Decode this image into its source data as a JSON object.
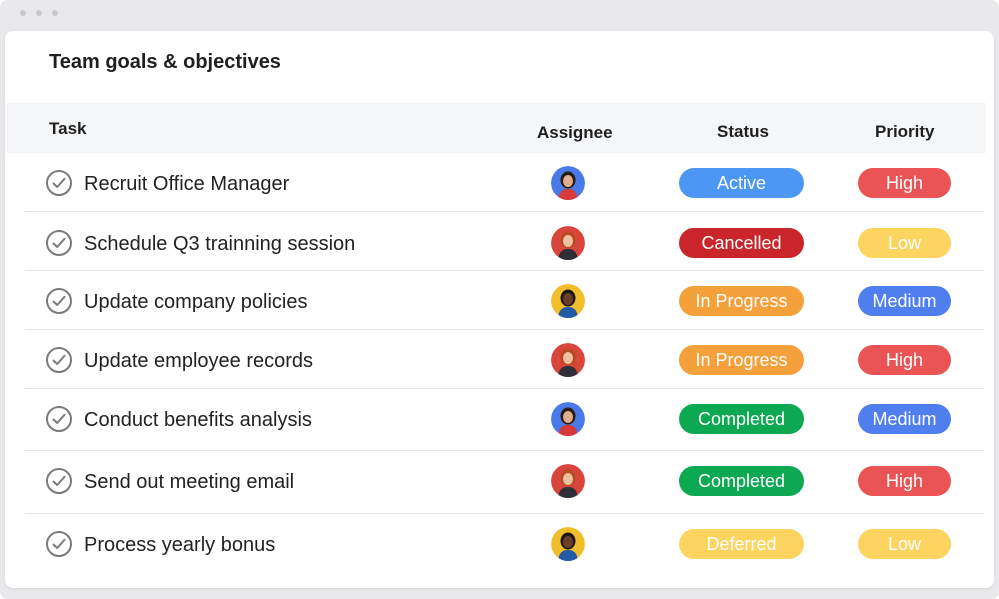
{
  "panel": {
    "title": "Team goals & objectives"
  },
  "columns": {
    "task": "Task",
    "assignee": "Assignee",
    "status": "Status",
    "priority": "Priority"
  },
  "colors": {
    "Active": "#4c97f3",
    "Cancelled": "#c9252b",
    "In Progress": "#f4a03b",
    "Completed": "#0ca952",
    "Deferred": "#fdd460",
    "High": "#ea5455",
    "Low": "#fdd460",
    "Medium": "#4f7fef"
  },
  "avatars": {
    "a": {
      "bg": "#4a7ae8",
      "hair": "#2a1a14",
      "skin": "#e2ae8e",
      "shirt": "#d63a3a"
    },
    "b": {
      "bg": "#d9443c",
      "hair": "#b64b1f",
      "skin": "#efc1a0",
      "shirt": "#2e2e38"
    },
    "c": {
      "bg": "#f2bd2a",
      "hair": "#1a1a1a",
      "skin": "#6a3f28",
      "shirt": "#1f5aa6"
    }
  },
  "rows": [
    {
      "task": "Recruit Office Manager",
      "avatar": "a",
      "avatar_icon": "woman-avatar",
      "status": "Active",
      "priority": "High"
    },
    {
      "task": "Schedule Q3 trainning session",
      "avatar": "b",
      "avatar_icon": "woman-avatar",
      "status": "Cancelled",
      "priority": "Low"
    },
    {
      "task": "Update company policies",
      "avatar": "c",
      "avatar_icon": "man-avatar",
      "status": "In Progress",
      "priority": "Medium"
    },
    {
      "task": "Update employee records",
      "avatar": "b",
      "avatar_icon": "woman-avatar",
      "status": "In Progress",
      "priority": "High"
    },
    {
      "task": "Conduct benefits analysis",
      "avatar": "a",
      "avatar_icon": "woman-avatar",
      "status": "Completed",
      "priority": "Medium"
    },
    {
      "task": "Send out meeting email",
      "avatar": "b",
      "avatar_icon": "woman-avatar",
      "status": "Completed",
      "priority": "High"
    },
    {
      "task": "Process yearly bonus",
      "avatar": "c",
      "avatar_icon": "man-avatar",
      "status": "Deferred",
      "priority": "Low"
    }
  ]
}
